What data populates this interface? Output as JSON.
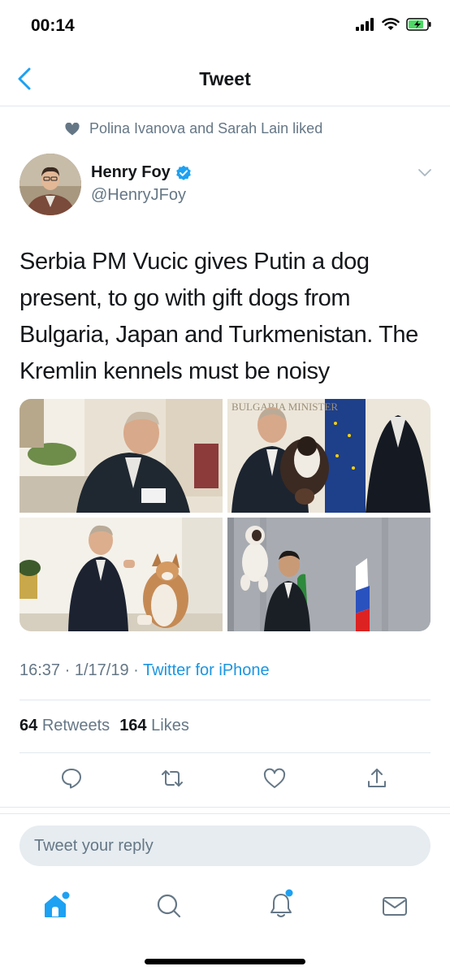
{
  "status_bar": {
    "time": "00:14"
  },
  "nav": {
    "title": "Tweet"
  },
  "social_context": {
    "text": "Polina Ivanova and Sarah Lain liked"
  },
  "author": {
    "name": "Henry Foy",
    "handle": "@HenryJFoy",
    "verified": true
  },
  "tweet": {
    "text": "Serbia PM Vucic gives Putin a dog present, to go with gift dogs from Bulgaria, Japan and Turkmenistan. The Kremlin kennels must be noisy",
    "images": [
      {
        "description": "photo-putin-with-dog-indoors"
      },
      {
        "description": "photo-putin-with-puppy-bulgaria"
      },
      {
        "description": "photo-putin-with-akita"
      },
      {
        "description": "photo-turkmen-leader-with-puppy"
      }
    ],
    "sign_text": "BULGARIA MINISTER"
  },
  "meta": {
    "time": "16:37",
    "separator": "·",
    "date": "1/17/19",
    "source": "Twitter for iPhone"
  },
  "stats": {
    "retweets_count": "64",
    "retweets_label": "Retweets",
    "likes_count": "164",
    "likes_label": "Likes"
  },
  "actions": [
    "reply-icon",
    "retweet-icon",
    "like-icon",
    "share-icon"
  ],
  "reply": {
    "placeholder": "Tweet your reply"
  },
  "tabs": [
    "home-icon",
    "search-icon",
    "notifications-icon",
    "messages-icon"
  ],
  "colors": {
    "accent": "#1da1f2",
    "link": "#1b95e0",
    "secondary_text": "#657786",
    "icon_gray": "#657786",
    "divider": "#e1e8ed"
  }
}
